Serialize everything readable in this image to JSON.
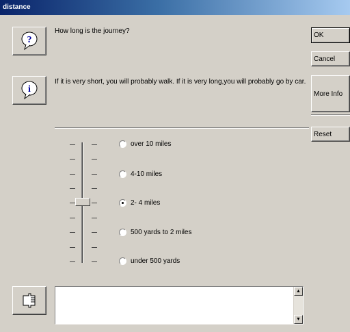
{
  "window": {
    "title": "distance"
  },
  "question": {
    "icon": "question-balloon-icon",
    "text": "How long is the journey?"
  },
  "info": {
    "icon": "info-balloon-icon",
    "text": "If it is very short, you will probably walk.   If it is very long,you will probably go by car."
  },
  "buttons": {
    "ok": "OK",
    "cancel": "Cancel",
    "more_info": "More Info",
    "reset": "Reset"
  },
  "slider": {
    "selected_index": 2,
    "steps": 5
  },
  "options": [
    {
      "label": "over 10 miles",
      "selected": false
    },
    {
      "label": "4-10 miles",
      "selected": false
    },
    {
      "label": "2- 4 miles",
      "selected": true
    },
    {
      "label": "500 yards to 2 miles",
      "selected": false
    },
    {
      "label": "under 500 yards",
      "selected": false
    }
  ],
  "notes": {
    "icon": "pointing-hand-icon",
    "value": ""
  }
}
